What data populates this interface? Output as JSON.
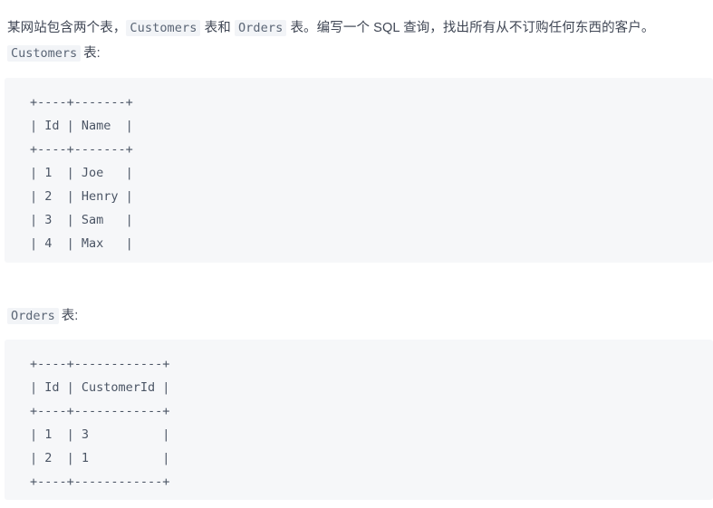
{
  "document": {
    "intro": {
      "part1": "某网站包含两个表，",
      "code1": "Customers",
      "part2": " 表和 ",
      "code2": "Orders",
      "part3": " 表。编写一个 SQL 查询，找出所有从不订购任何东西的客户。"
    },
    "sections": [
      {
        "caption_code": "Customers",
        "caption_suffix": "表:",
        "table": {
          "columns": [
            "Id",
            "Name"
          ],
          "rows": [
            [
              "1",
              "Joe"
            ],
            [
              "2",
              "Henry"
            ],
            [
              "3",
              "Sam"
            ],
            [
              "4",
              "Max"
            ]
          ],
          "ascii": "+----+-------+\n| Id | Name  |\n+----+-------+\n| 1  | Joe   |\n| 2  | Henry |\n| 3  | Sam   |\n| 4  | Max   |\n+----+-------+"
        }
      },
      {
        "caption_code": "Orders",
        "caption_suffix": "表:",
        "table": {
          "columns": [
            "Id",
            "CustomerId"
          ],
          "rows": [
            [
              "1",
              "3"
            ],
            [
              "2",
              "1"
            ]
          ],
          "ascii": "+----+------------+\n| Id | CustomerId |\n+----+------------+\n| 1  | 3          |\n| 2  | 1          |\n+----+------------+"
        }
      }
    ],
    "colors": {
      "page_background": "#ffffff",
      "body_text": "#3f4654",
      "code_block_background": "#f6f7f9",
      "code_text": "#4b5565",
      "inline_code_background": "#f2f4f7",
      "inline_code_text": "#5a6575"
    }
  }
}
